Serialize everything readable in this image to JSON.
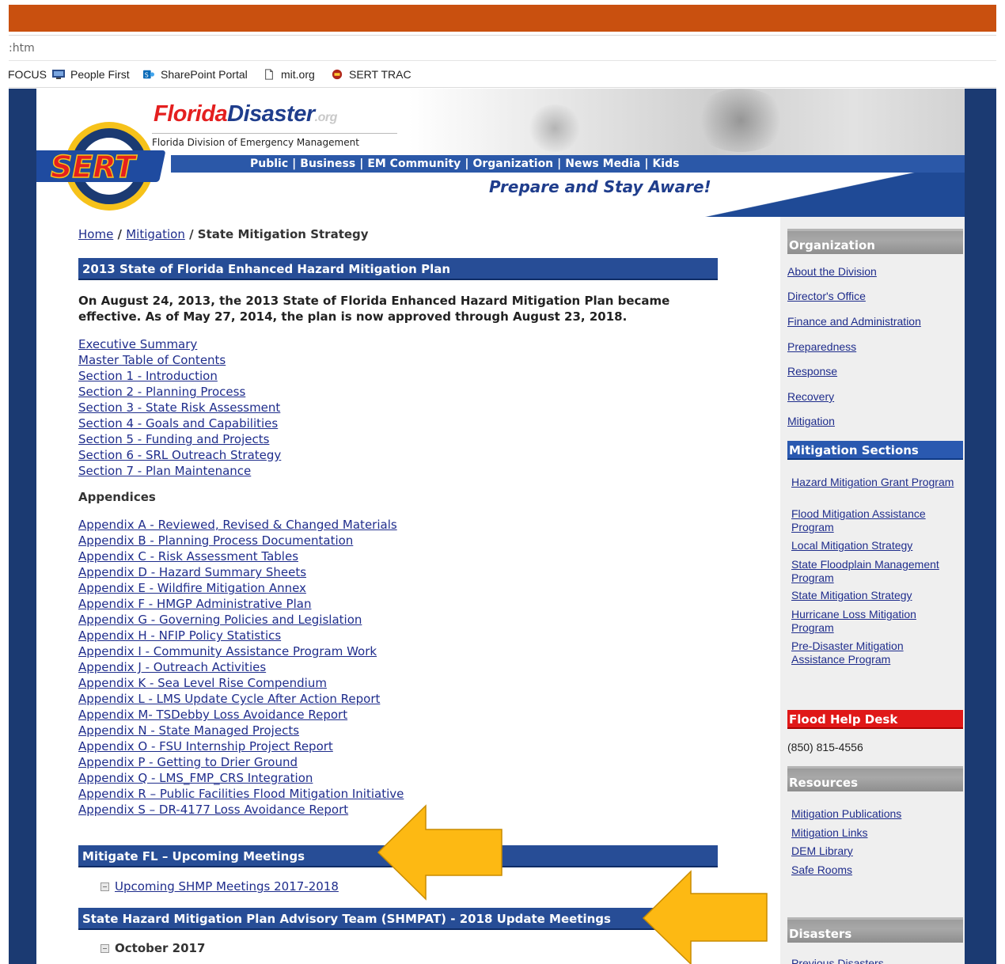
{
  "browser": {
    "url_fragment": ":htm",
    "bookmarks": [
      {
        "label": "FOCUS",
        "icon": "none"
      },
      {
        "label": "People First",
        "icon": "monitor-icon"
      },
      {
        "label": "SharePoint Portal",
        "icon": "sharepoint-icon"
      },
      {
        "label": "mit.org",
        "icon": "page-icon"
      },
      {
        "label": "SERT TRAC",
        "icon": "sert-icon"
      }
    ]
  },
  "header": {
    "logo_florida": "Florida",
    "logo_disaster": "Disaster",
    "logo_org": ".org",
    "logo_subtitle": "Florida Division of Emergency Management",
    "badge_text": "SERT",
    "nav": [
      "Public",
      "Business",
      "EM Community",
      "Organization",
      "News Media",
      "Kids"
    ],
    "tagline": "Prepare and Stay Aware!"
  },
  "breadcrumb": {
    "home": "Home",
    "sep": " / ",
    "mitigation": "Mitigation",
    "current": "State Mitigation Strategy"
  },
  "main": {
    "plan_heading": "2013 State of Florida Enhanced Hazard Mitigation Plan",
    "intro": "On August 24, 2013, the 2013 State of Florida Enhanced Hazard Mitigation Plan became effective. As of May 27, 2014, the plan is now approved through August 23, 2018.",
    "sections": [
      "Executive Summary",
      "Master Table of Contents",
      "Section 1 - Introduction",
      "Section 2 - Planning Process",
      "Section 3 - State Risk Assessment",
      "Section 4 - Goals and Capabilities",
      "Section 5 - Funding and Projects",
      "Section 6 - SRL Outreach Strategy",
      "Section 7 - Plan Maintenance"
    ],
    "appendices_label": "Appendices",
    "appendices": [
      "Appendix A - Reviewed, Revised & Changed Materials",
      "Appendix B - Planning Process Documentation",
      "Appendix C - Risk Assessment Tables",
      "Appendix D - Hazard Summary Sheets",
      "Appendix E - Wildfire Mitigation Annex",
      "Appendix F - HMGP Administrative Plan",
      "Appendix G - Governing Policies and Legislation",
      "Appendix H - NFIP Policy Statistics",
      "Appendix I - Community Assistance Program Work",
      "Appendix J - Outreach Activities",
      "Appendix K - Sea Level Rise Compendium",
      "Appendix L - LMS Update Cycle After Action Report",
      "Appendix M- TSDebby Loss Avoidance Report",
      "Appendix N - State Managed Projects",
      "Appendix O - FSU Internship Project Report",
      "Appendix P - Getting to Drier Ground",
      "Appendix Q - LMS_FMP_CRS Integration",
      "Appendix R – Public Facilities Flood Mitigation Initiative",
      "Appendix S – DR-4177 Loss Avoidance Report"
    ],
    "meetings_heading": "Mitigate FL – Upcoming Meetings",
    "meetings_link": "Upcoming SHMP Meetings 2017-2018",
    "shmpat_heading": "State Hazard Mitigation Plan Advisory Team (SHMPAT) - 2018 Update Meetings",
    "shmpat_item": "October 2017"
  },
  "sidebar": {
    "org_heading": "Organization",
    "org_links": [
      "About the Division",
      "Director's Office",
      "Finance and Administration",
      "Preparedness",
      "Response",
      "Recovery",
      "Mitigation"
    ],
    "mit_heading": "Mitigation Sections",
    "mit_links": [
      "Hazard Mitigation Grant Program",
      "Flood Mitigation Assistance Program",
      "Local Mitigation Strategy",
      "State Floodplain Management Program",
      "State Mitigation Strategy",
      "Hurricane Loss Mitigation Program",
      "Pre-Disaster Mitigation Assistance Program"
    ],
    "flood_heading": "Flood Help Desk",
    "flood_phone": "(850) 815-4556",
    "resources_heading": "Resources",
    "resources_links": [
      "Mitigation Publications",
      "Mitigation Links",
      "DEM Library",
      "Safe Rooms"
    ],
    "disasters_heading": "Disasters",
    "disasters_link": "Previous Disasters"
  },
  "colors": {
    "top_bar": "#c9500f",
    "frame": "#1b3a72",
    "section_head": "#274d96",
    "arrow": "#fdb913"
  }
}
